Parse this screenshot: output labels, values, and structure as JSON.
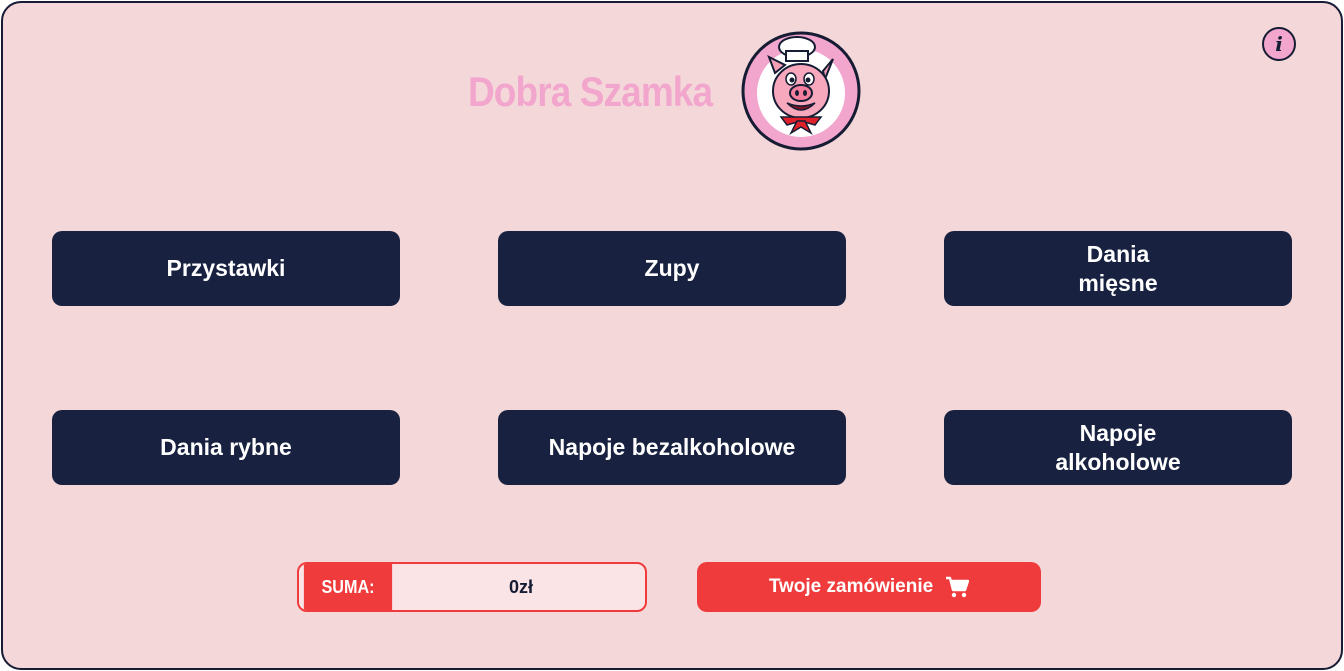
{
  "header": {
    "title": "Dobra Szamka",
    "logo_icon": "chef-pig-logo-icon",
    "info_label": "i",
    "info_icon": "info-icon"
  },
  "categories": [
    {
      "label": "Przystawki"
    },
    {
      "label": "Zupy"
    },
    {
      "label": "Dania mięsne"
    },
    {
      "label": "Dania rybne"
    },
    {
      "label": "Napoje bezalkoholowe"
    },
    {
      "label": "Napoje alkoholowe"
    }
  ],
  "footer": {
    "suma_label": "SUMA:",
    "suma_value": "0zł",
    "order_label": "Twoje zamówienie",
    "order_icon": "cart-icon"
  },
  "colors": {
    "background": "#f4d7d8",
    "navy": "#182240",
    "pink": "#f2a6cd",
    "red": "#ef3b3c"
  }
}
